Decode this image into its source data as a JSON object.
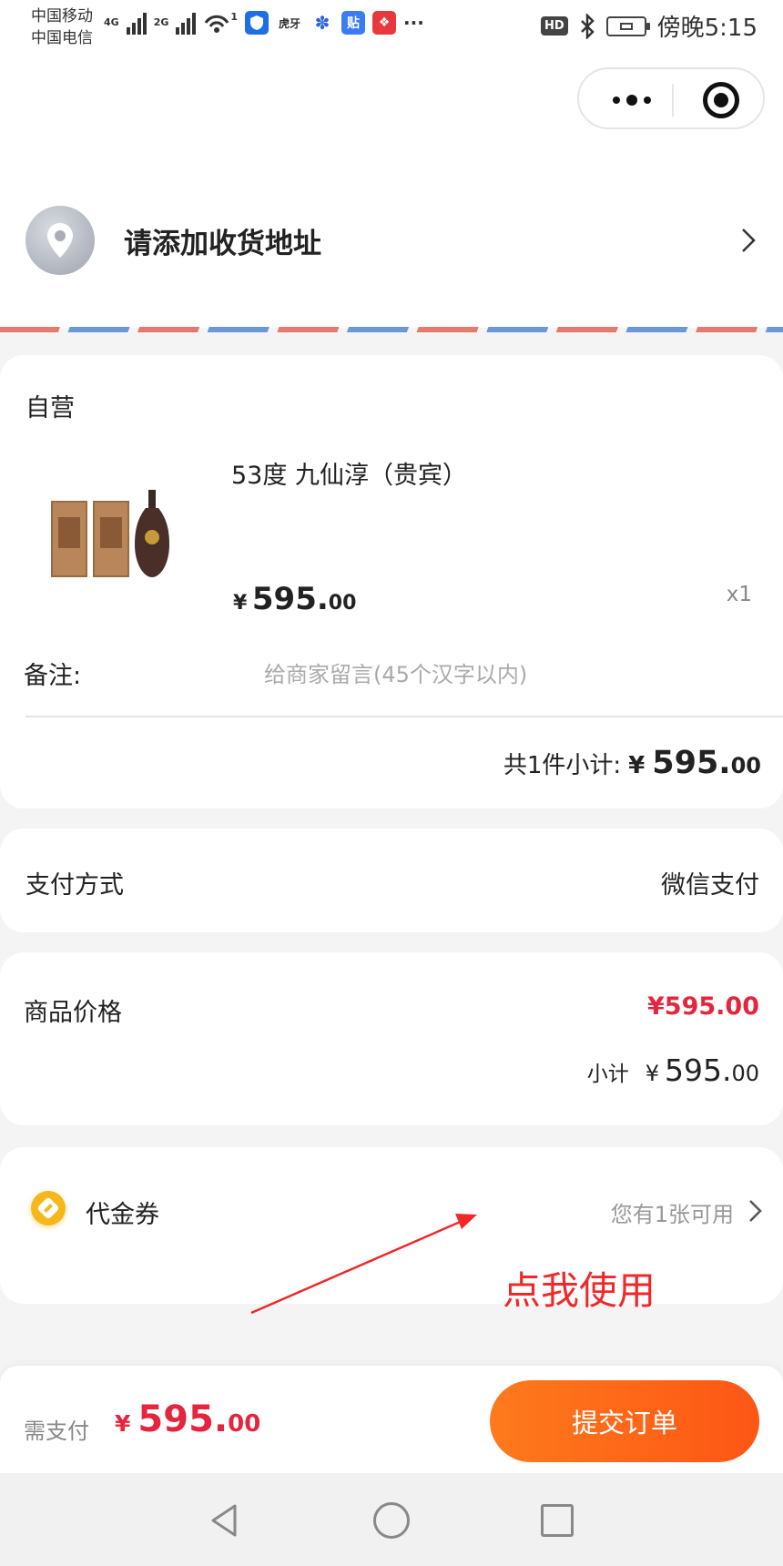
{
  "status_bar": {
    "carrier_1": "中国移动",
    "carrier_2": "中国电信",
    "net_1": "4G",
    "net_2": "2G",
    "wifi_badge": "1",
    "hd": "HD",
    "time": "傍晚5:15",
    "more": "···",
    "icons": [
      "signal-icon",
      "wifi-icon",
      "shield-app-icon",
      "huya-app-icon",
      "baidu-app-icon",
      "tieba-app-icon",
      "app-icon",
      "bluetooth-icon",
      "battery-icon"
    ],
    "tieba_label": "贴",
    "huya_label": "虎牙"
  },
  "capsule": {
    "icons": [
      "more-icon",
      "close-target-icon"
    ]
  },
  "address": {
    "label": "请添加收货地址"
  },
  "order": {
    "shop": "自营",
    "product_name": "53度 九仙淳（贵宾）",
    "price_currency": "¥",
    "price_int": "595.",
    "price_dec": "00",
    "quantity": "x1",
    "remark_label": "备注:",
    "remark_placeholder": "给商家留言(45个汉字以内)",
    "subtotal_label": "共1件小计:",
    "subtotal_currency": "¥",
    "subtotal_int": "595.",
    "subtotal_dec": "00"
  },
  "payment": {
    "label": "支付方式",
    "value": "微信支付"
  },
  "price": {
    "label": "商品价格",
    "value": "¥595.00",
    "subtotal_label": "小计",
    "subtotal_currency": "¥",
    "subtotal_int": "595.",
    "subtotal_dec": "00"
  },
  "coupon": {
    "label": "代金券",
    "value": "您有1张可用"
  },
  "annotation": {
    "text": "点我使用"
  },
  "footer": {
    "need_pay_label": "需支付",
    "currency": "¥",
    "total_int": "595.",
    "total_dec": "00",
    "submit_label": "提交订单"
  },
  "colors": {
    "accent_red": "#e5253d",
    "button_orange": "#fd5615",
    "annotation_red": "#f0282a"
  }
}
